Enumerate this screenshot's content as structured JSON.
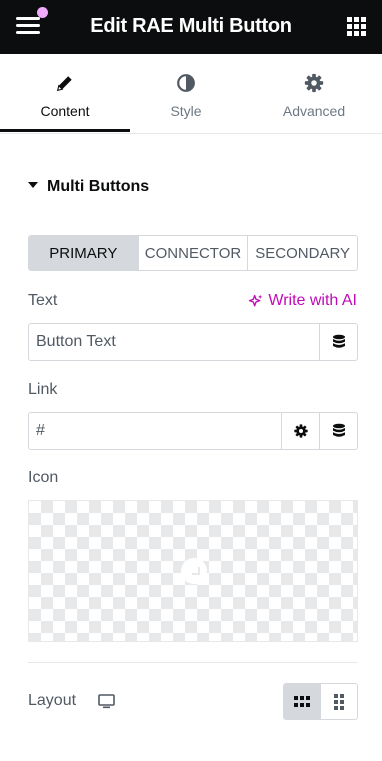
{
  "header": {
    "title": "Edit RAE Multi Button",
    "menu_icon": "hamburger-icon",
    "apps_icon": "grid-icon",
    "notification_color": "#f0abfc"
  },
  "tabs": [
    {
      "label": "Content",
      "icon": "pencil-icon",
      "active": true
    },
    {
      "label": "Style",
      "icon": "half-circle-icon",
      "active": false
    },
    {
      "label": "Advanced",
      "icon": "gear-icon",
      "active": false
    }
  ],
  "section": {
    "title": "Multi Buttons",
    "expanded": true
  },
  "button_tabs": [
    {
      "label": "PRIMARY",
      "active": true
    },
    {
      "label": "CONNECTOR",
      "active": false
    },
    {
      "label": "SECONDARY",
      "active": false
    }
  ],
  "text_field": {
    "label": "Text",
    "ai_link": "Write with AI",
    "placeholder": "Button Text",
    "value": "",
    "dynamic_icon": "database-icon"
  },
  "link_field": {
    "label": "Link",
    "placeholder": "#",
    "value": "",
    "options_icon": "gear-icon",
    "dynamic_icon": "database-icon"
  },
  "icon_field": {
    "label": "Icon"
  },
  "layout_field": {
    "label": "Layout",
    "device_icon": "desktop-icon",
    "options": [
      {
        "icon": "inline-grid-icon",
        "active": true
      },
      {
        "icon": "stacked-grid-icon",
        "active": false
      }
    ]
  },
  "colors": {
    "topbar": "#0c0d0e",
    "accent_ai": "#c00bb9",
    "border": "#d5d8dc",
    "text": "#515962"
  }
}
